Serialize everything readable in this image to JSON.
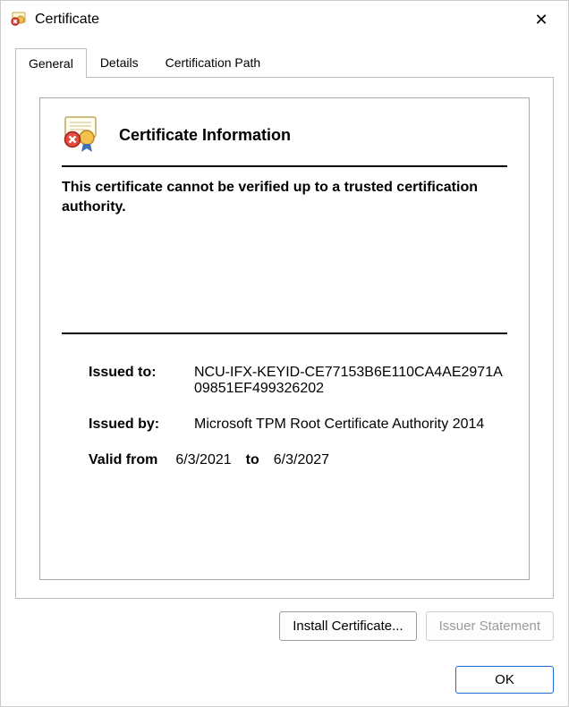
{
  "window": {
    "title": "Certificate",
    "close_glyph": "✕"
  },
  "tabs": {
    "general": "General",
    "details": "Details",
    "certpath": "Certification Path"
  },
  "cert": {
    "header": "Certificate Information",
    "warning": "This certificate cannot be verified up to a trusted certification authority.",
    "issued_to_label": "Issued to:",
    "issued_to_value": "NCU-IFX-KEYID-CE77153B6E110CA4AE2971A09851EF499326202",
    "issued_by_label": "Issued by:",
    "issued_by_value": "Microsoft TPM Root Certificate Authority 2014",
    "valid_from_label": "Valid from",
    "valid_from": "6/3/2021",
    "valid_to_label": "to",
    "valid_to": "6/3/2027"
  },
  "buttons": {
    "install": "Install Certificate...",
    "issuer": "Issuer Statement",
    "ok": "OK"
  }
}
